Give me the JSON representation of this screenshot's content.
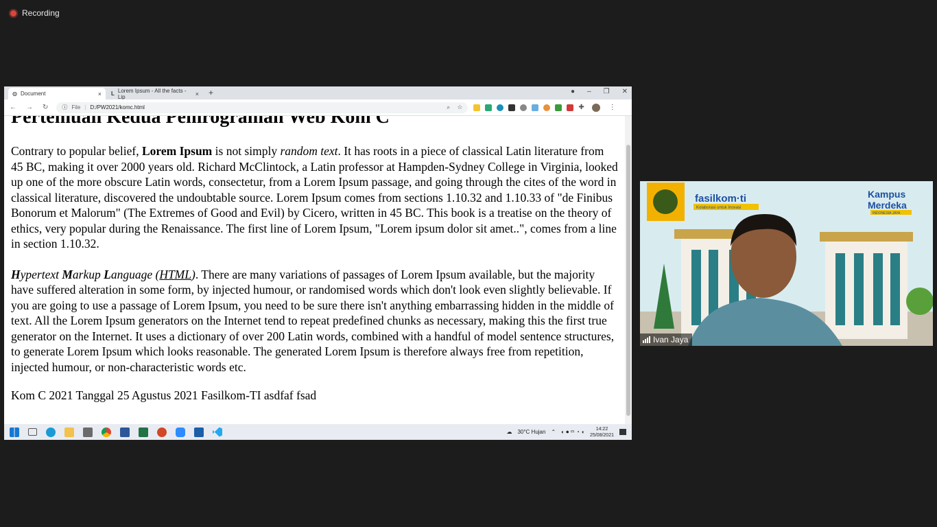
{
  "recording": {
    "label": "Recording"
  },
  "browser": {
    "tabs": [
      {
        "title": "Document",
        "close": "×"
      },
      {
        "title": "Lorem Ipsum - All the facts - Lip",
        "close": "×"
      }
    ],
    "new_tab": "+",
    "address": {
      "scheme": "File",
      "url": "D:/PW2021/komc.html"
    }
  },
  "document": {
    "heading": "Pertemuan Kedua Pemrograman Web Kom C",
    "p1": {
      "a": "Contrary to popular belief, ",
      "b": "Lorem Ipsum",
      "c": " is not simply ",
      "d": "random text",
      "e": ". It has roots in a piece of classical Latin literature from 45 BC, making it over 2000 years old. Richard McClintock, a Latin professor at Hampden-Sydney College in Virginia, looked up one of the more obscure Latin words, consectetur, from a Lorem Ipsum passage, and going through the cites of the word in classical literature, discovered the undoubtable source. Lorem Ipsum comes from sections 1.10.32 and 1.10.33 of \"de Finibus Bonorum et Malorum\" (The Extremes of Good and Evil) by Cicero, written in 45 BC. This book is a treatise on the theory of ethics, very popular during the Renaissance. The first line of Lorem Ipsum, \"Lorem ipsum dolor sit amet..\", comes from a line in section 1.10.32."
    },
    "p2": {
      "h": "H",
      "ypertext": "ypertext ",
      "m": "M",
      "arkup": "arkup ",
      "l": "L",
      "anguage": "anguage (",
      "abbr": "HTML",
      "close": ")",
      "rest": ". There are many variations of passages of Lorem Ipsum available, but the majority have suffered alteration in some form, by injected humour, or randomised words which don't look even slightly believable. If you are going to use a passage of Lorem Ipsum, you need to be sure there isn't anything embarrassing hidden in the middle of text. All the Lorem Ipsum generators on the Internet tend to repeat predefined chunks as necessary, making this the first true generator on the Internet. It uses a dictionary of over 200 Latin words, combined with a handful of model sentence structures, to generate Lorem Ipsum which looks reasonable. The generated Lorem Ipsum is therefore always free from repetition, injected humour, or non-characteristic words etc."
    },
    "footer": "Kom C 2021 Tanggal 25 Agustus 2021 Fasilkom-TI asdfaf fsad"
  },
  "taskbar": {
    "weather": "30°C  Hujan",
    "time": "14:22",
    "date": "25/08/2021"
  },
  "participant": {
    "name": "Ivan Jaya",
    "brand1": "fasilkom·ti",
    "brand1_sub": "Kolaborasi untuk Inovasi",
    "brand2": "Kampus Merdeka",
    "brand2_sub": "INDONESIA JAYA"
  }
}
